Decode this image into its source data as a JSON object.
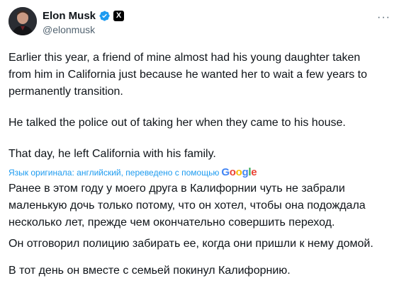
{
  "author": {
    "name": "Elon Musk",
    "handle": "@elonmusk",
    "verified_icon": "verified-badge-icon",
    "affiliation_icon": "x-logo-icon",
    "affiliation_label": "X"
  },
  "menu_icon": "more-options-icon",
  "original": {
    "p1": "Earlier this year, a friend of mine almost had his young daughter taken from him in California just because he wanted her to wait a few years to permanently transition.",
    "p2": "He talked the police out of taking her when they came to his house.",
    "p3": "That day, he left California with his family."
  },
  "translation": {
    "note": "Язык оригинала: английский, переведено с помощью",
    "provider_letters": [
      "G",
      "o",
      "o",
      "g",
      "l",
      "e"
    ],
    "p1": "Ранее в этом году у моего друга в Калифорнии чуть не забрали маленькую дочь только потому, что он хотел, чтобы она подождала несколько лет, прежде чем окончательно совершить переход.",
    "p2": "Он отговорил полицию забирать ее, когда они пришли к нему домой.",
    "p3": "В тот день он вместе с семьей покинул Калифорнию."
  },
  "colors": {
    "text": "#0f1419",
    "secondary": "#536471",
    "link": "#1d9bf0",
    "verified": "#1d9bf0"
  }
}
